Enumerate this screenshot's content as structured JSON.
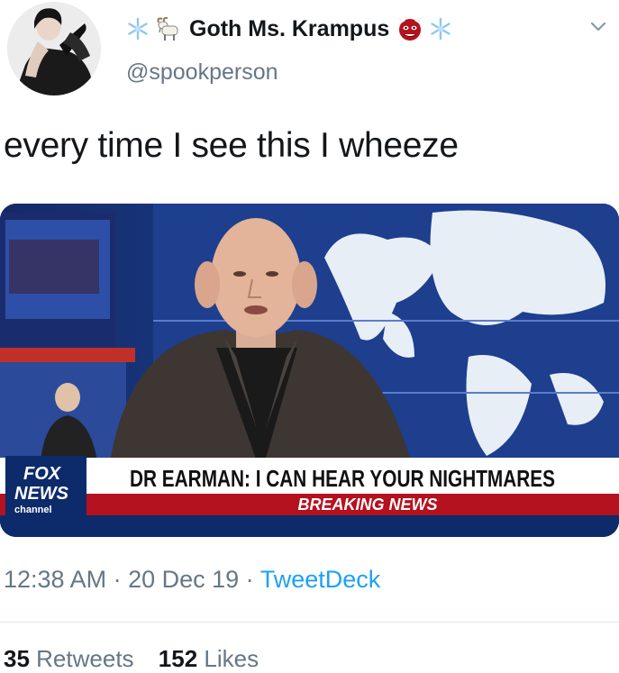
{
  "user": {
    "display_name": "Goth Ms. Krampus",
    "handle": "@spookperson"
  },
  "tweet": {
    "text": "every time I see this I wheeze",
    "time": "12:38 AM",
    "date": "20 Dec 19",
    "source": "TweetDeck",
    "separator": " · "
  },
  "stats": {
    "retweets_count": "35",
    "retweets_label": "Retweets",
    "likes_count": "152",
    "likes_label": "Likes"
  },
  "media": {
    "channel_logo_top": "FOX",
    "channel_logo_bottom": "NEWS",
    "channel_logo_sub": "channel",
    "headline": "DR EARMAN: I CAN HEAR YOUR NIGHTMARES",
    "ticker": "BREAKING NEWS"
  }
}
